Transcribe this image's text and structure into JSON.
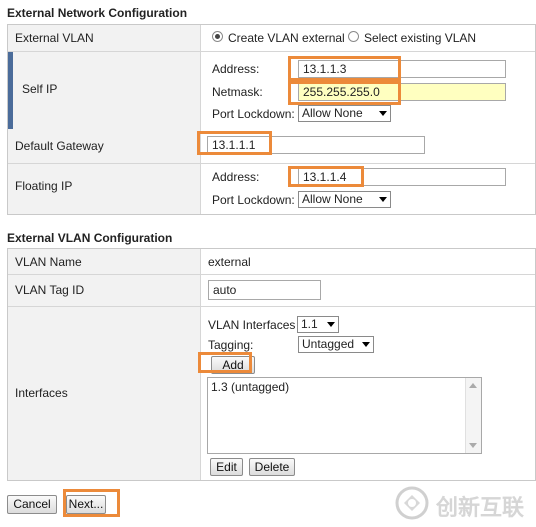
{
  "ext_network": {
    "title": "External Network Configuration",
    "external_vlan": {
      "label": "External VLAN",
      "option_create": "Create VLAN external",
      "option_select": "Select existing VLAN"
    },
    "self_ip": {
      "label": "Self IP",
      "address_label": "Address:",
      "address_value": "13.1.1.3",
      "netmask_label": "Netmask:",
      "netmask_value": "255.255.255.0",
      "lockdown_label": "Port Lockdown:",
      "lockdown_value": "Allow None"
    },
    "default_gateway": {
      "label": "Default Gateway",
      "value": "13.1.1.1"
    },
    "floating_ip": {
      "label": "Floating IP",
      "address_label": "Address:",
      "address_value": "13.1.1.4",
      "lockdown_label": "Port Lockdown:",
      "lockdown_value": "Allow None"
    }
  },
  "ext_vlan": {
    "title": "External VLAN Configuration",
    "vlan_name": {
      "label": "VLAN Name",
      "value": "external"
    },
    "vlan_tag": {
      "label": "VLAN Tag ID",
      "value": "auto"
    },
    "interfaces": {
      "label": "Interfaces",
      "vlan_interfaces_label": "VLAN Interfaces",
      "vlan_interfaces_value": "1.1",
      "tagging_label": "Tagging:",
      "tagging_value": "Untagged",
      "add_label": "Add",
      "list_items": [
        "1.3 (untagged)"
      ],
      "edit_label": "Edit",
      "delete_label": "Delete"
    }
  },
  "footer": {
    "cancel_label": "Cancel",
    "next_label": "Next..."
  },
  "watermark": {
    "text": "创新互联"
  },
  "colors": {
    "highlight": "#ec8a3a",
    "accent_bar": "#4b6c9a",
    "yellow_field": "#ffffc0"
  }
}
